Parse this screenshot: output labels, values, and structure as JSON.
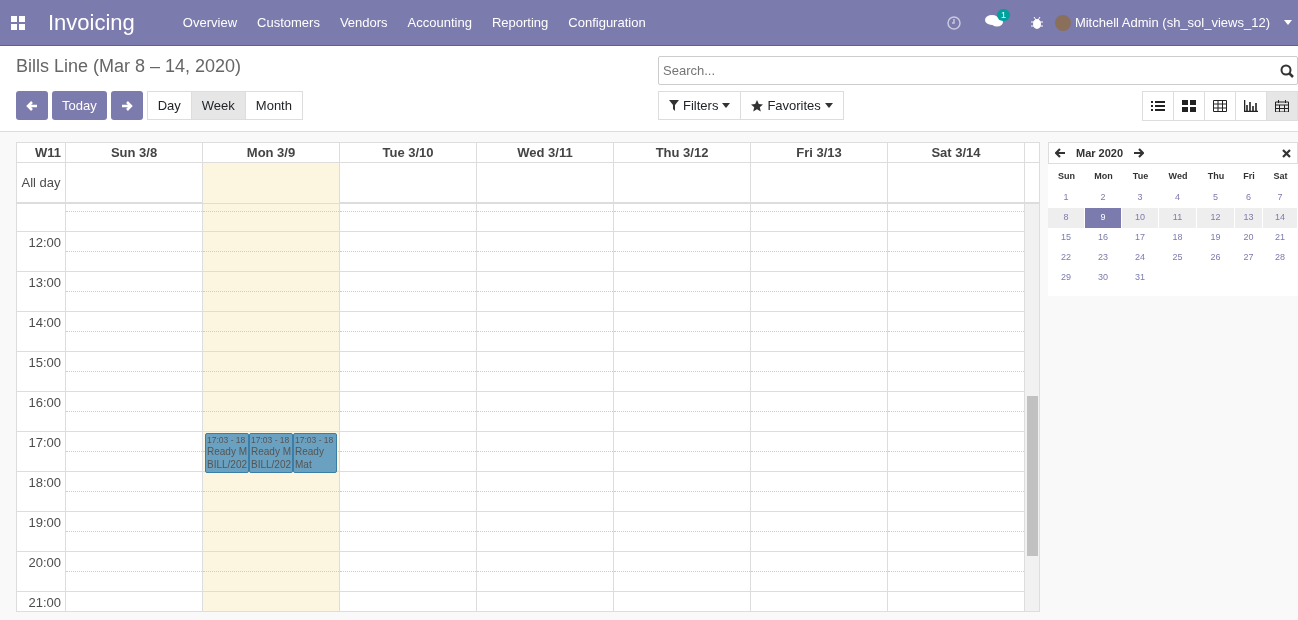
{
  "navbar": {
    "app_name": "Invoicing",
    "menu": [
      "Overview",
      "Customers",
      "Vendors",
      "Accounting",
      "Reporting",
      "Configuration"
    ],
    "messages_badge": "1",
    "user": "Mitchell Admin (sh_sol_views_12)"
  },
  "control_panel": {
    "title": "Bills Line (Mar 8 – 14, 2020)",
    "today": "Today",
    "scales": [
      {
        "label": "Day",
        "selected": false
      },
      {
        "label": "Week",
        "selected": true
      },
      {
        "label": "Month",
        "selected": false
      }
    ],
    "search": {
      "placeholder": "Search..."
    },
    "filters": "Filters",
    "favorites": "Favorites",
    "views": [
      {
        "kind": "list",
        "selected": false
      },
      {
        "kind": "kanban",
        "selected": false
      },
      {
        "kind": "pivot",
        "selected": false
      },
      {
        "kind": "graph",
        "selected": false
      },
      {
        "kind": "calendar",
        "selected": true
      }
    ]
  },
  "calendar": {
    "week": "W11",
    "all_day": "All day",
    "days": [
      {
        "label": "Sun 3/8",
        "today": false
      },
      {
        "label": "Mon 3/9",
        "today": true
      },
      {
        "label": "Tue 3/10",
        "today": false
      },
      {
        "label": "Wed 3/11",
        "today": false
      },
      {
        "label": "Thu 3/12",
        "today": false
      },
      {
        "label": "Fri 3/13",
        "today": false
      },
      {
        "label": "Sat 3/14",
        "today": false
      }
    ],
    "hours": [
      "12:00",
      "13:00",
      "14:00",
      "15:00",
      "16:00",
      "17:00",
      "18:00",
      "19:00",
      "20:00",
      "21:00"
    ],
    "events": [
      {
        "time": "17:03 - 18",
        "lines": [
          "Ready M",
          "BILL/202"
        ]
      },
      {
        "time": "17:03 - 18",
        "lines": [
          "Ready M",
          "BILL/202"
        ]
      },
      {
        "time": "17:03 - 18",
        "lines": [
          "Ready",
          "Mat"
        ]
      }
    ]
  },
  "mini_calendar": {
    "month": "Mar 2020",
    "weekdays": [
      "Sun",
      "Mon",
      "Tue",
      "Wed",
      "Thu",
      "Fri",
      "Sat"
    ],
    "weeks": [
      [
        {
          "day": "1",
          "in_week": false,
          "selected": false
        },
        {
          "day": "2",
          "in_week": false,
          "selected": false
        },
        {
          "day": "3",
          "in_week": false,
          "selected": false
        },
        {
          "day": "4",
          "in_week": false,
          "selected": false
        },
        {
          "day": "5",
          "in_week": false,
          "selected": false
        },
        {
          "day": "6",
          "in_week": false,
          "selected": false
        },
        {
          "day": "7",
          "in_week": false,
          "selected": false
        }
      ],
      [
        {
          "day": "8",
          "in_week": true,
          "selected": false
        },
        {
          "day": "9",
          "in_week": true,
          "selected": true
        },
        {
          "day": "10",
          "in_week": true,
          "selected": false
        },
        {
          "day": "11",
          "in_week": true,
          "selected": false
        },
        {
          "day": "12",
          "in_week": true,
          "selected": false
        },
        {
          "day": "13",
          "in_week": true,
          "selected": false
        },
        {
          "day": "14",
          "in_week": true,
          "selected": false
        }
      ],
      [
        {
          "day": "15",
          "in_week": false,
          "selected": false
        },
        {
          "day": "16",
          "in_week": false,
          "selected": false
        },
        {
          "day": "17",
          "in_week": false,
          "selected": false
        },
        {
          "day": "18",
          "in_week": false,
          "selected": false
        },
        {
          "day": "19",
          "in_week": false,
          "selected": false
        },
        {
          "day": "20",
          "in_week": false,
          "selected": false
        },
        {
          "day": "21",
          "in_week": false,
          "selected": false
        }
      ],
      [
        {
          "day": "22",
          "in_week": false,
          "selected": false
        },
        {
          "day": "23",
          "in_week": false,
          "selected": false
        },
        {
          "day": "24",
          "in_week": false,
          "selected": false
        },
        {
          "day": "25",
          "in_week": false,
          "selected": false
        },
        {
          "day": "26",
          "in_week": false,
          "selected": false
        },
        {
          "day": "27",
          "in_week": false,
          "selected": false
        },
        {
          "day": "28",
          "in_week": false,
          "selected": false
        }
      ],
      [
        {
          "day": "29",
          "in_week": false,
          "selected": false
        },
        {
          "day": "30",
          "in_week": false,
          "selected": false
        },
        {
          "day": "31",
          "in_week": false,
          "selected": false
        }
      ]
    ]
  }
}
